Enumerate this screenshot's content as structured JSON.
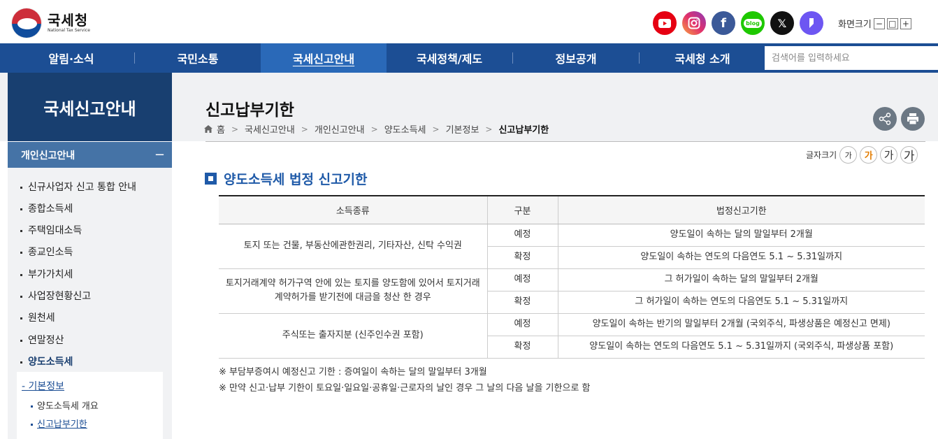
{
  "header": {
    "logo_title": "국세청",
    "logo_sub": "National Tax Service",
    "sns": [
      "youtube-icon",
      "instagram-icon",
      "facebook-icon",
      "blog-icon",
      "x-icon",
      "story-icon"
    ],
    "sns_blog_label": "blog",
    "screen_size_label": "화면크기",
    "screen_btns": [
      "−",
      "□",
      "+"
    ]
  },
  "gnb": {
    "items": [
      "알림·소식",
      "국민소통",
      "국세신고안내",
      "국세정책/제도",
      "정보공개",
      "국세청 소개"
    ],
    "active_index": 2,
    "search_placeholder": "검색어를 입력하세요"
  },
  "lnb": {
    "title": "국세신고안내",
    "sub_title": "개인신고안내",
    "sub_toggle": "−",
    "items": [
      "신규사업자 신고 통합 안내",
      "종합소득세",
      "주택임대소득",
      "종교인소득",
      "부가가치세",
      "사업장현황신고",
      "원천세",
      "연말정산",
      "양도소득세"
    ],
    "active_item_index": 8,
    "sub2_head": "기본정보",
    "sub2_items": [
      "양도소득세 개요",
      "신고납부기한"
    ],
    "sub2_active_index": 1
  },
  "page": {
    "title": "신고납부기한",
    "breadcrumb": [
      "홈",
      "국세신고안내",
      "개인신고안내",
      "양도소득세",
      "기본정보",
      "신고납부기한"
    ],
    "font_size_label": "글자크기",
    "font_btns": [
      "가",
      "가",
      "가",
      "가"
    ],
    "font_active_index": 1,
    "section_title": "양도소득세 법정 신고기한"
  },
  "table": {
    "headers": [
      "소득종류",
      "구분",
      "법정신고기한"
    ],
    "groups": [
      {
        "kind": "토지 또는 건물, 부동산에관한권리, 기타자산, 신탁 수익권",
        "rows": [
          {
            "type": "예정",
            "deadline": "양도일이 속하는 달의 말일부터 2개월"
          },
          {
            "type": "확정",
            "deadline": "양도일이 속하는 연도의 다음연도 5.1 ~ 5.31일까지"
          }
        ]
      },
      {
        "kind": "토지거래계약 허가구역 안에 있는 토지를 양도함에 있어서 토지거래 계약허가를 받기전에 대금을 청산 한 경우",
        "rows": [
          {
            "type": "예정",
            "deadline": "그 허가일이 속하는 달의 말일부터 2개월"
          },
          {
            "type": "확정",
            "deadline": "그 허가일이 속하는 연도의 다음연도 5.1 ~ 5.31일까지"
          }
        ]
      },
      {
        "kind": "주식또는 출자지분 (신주인수권 포함)",
        "rows": [
          {
            "type": "예정",
            "deadline": "양도일이 속하는 반기의 말일부터 2개월 (국외주식, 파생상품은 예정신고 면제)"
          },
          {
            "type": "확정",
            "deadline": "양도일이 속하는 연도의 다음연도 5.1 ~ 5.31일까지 (국외주식, 파생상품 포함)"
          }
        ]
      }
    ]
  },
  "notes": [
    "※ 부담부증여시 예정신고 기한 : 증여일이 속하는 달의 말일부터 3개월",
    "※ 만약 신고·납부 기한이 토요일·일요일·공휴일·근로자의 날인 경우 그 날의 다음 날을 기한으로 함"
  ],
  "colors": {
    "nav_bg": "#1c4e94",
    "nav_active": "#2a69b8",
    "lnb_title_bg": "#183f70",
    "lnb_sub_bg": "#4573a6",
    "section_accent": "#1f5aa8"
  }
}
